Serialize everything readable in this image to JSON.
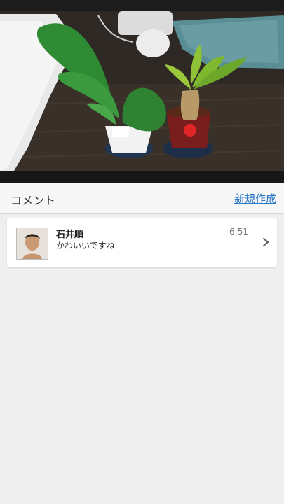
{
  "comments_section": {
    "title": "コメント",
    "new_label": "新規作成"
  },
  "comments": [
    {
      "author": "石井順",
      "text": "かわいいですね",
      "time": "6:51"
    }
  ],
  "colors": {
    "link": "#2a78c8",
    "background": "#efefef",
    "card": "#ffffff"
  },
  "icons": {
    "chevron": "chevron-right-icon",
    "avatar": "avatar-photo"
  }
}
